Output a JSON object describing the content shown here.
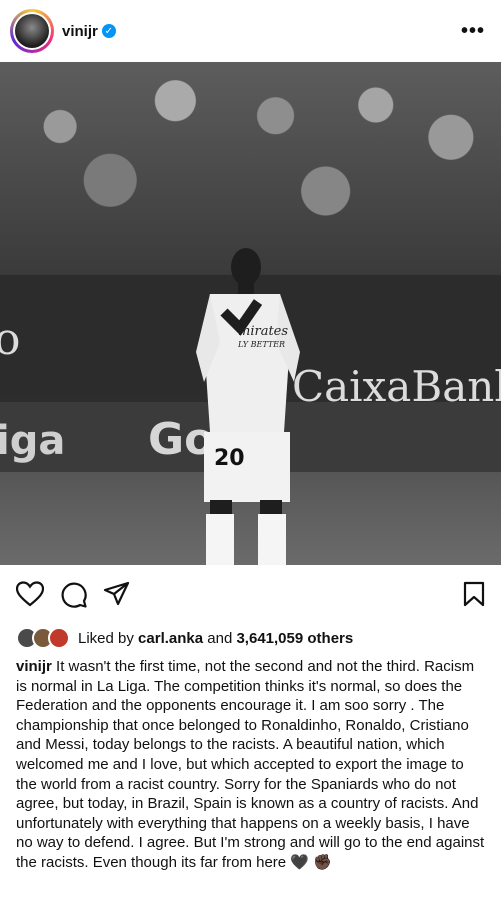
{
  "post": {
    "username": "vinijr",
    "verified_mark": "✓",
    "more_icon": "more-horizontal-icon",
    "photo": {
      "sponsor_board_main": "CaixaBank",
      "sponsor_board_left": "o",
      "sponsor_board_lower_left": "iga",
      "sponsor_board_lower_mid": "Go",
      "shirt_sponsor": "mirates",
      "shirt_sponsor_line2": "LY BETTER",
      "shirt_number": "20"
    },
    "actions": {
      "like_icon": "heart-icon",
      "comment_icon": "comment-icon",
      "share_icon": "paper-plane-icon",
      "save_icon": "bookmark-icon"
    },
    "likes": {
      "prefix": "Liked by",
      "user": "carl.anka",
      "connector": "and",
      "count": "3,641,059 others"
    },
    "caption": {
      "username": "vinijr",
      "text": "It wasn't the first time, not the second and not the third. Racism is normal in La Liga. The competition thinks it's normal, so does the Federation and the opponents encourage it. I am soo sorry . The championship that once belonged to Ronaldinho, Ronaldo, Cristiano and Messi, today belongs to the racists. A beautiful nation, which welcomed me and I love, but which accepted to export the image to the world from a racist country. Sorry for the Spaniards who do not agree, but today, in Brazil, Spain is known as a country of racists. And unfortunately with everything that happens on a weekly basis, I have no way to defend. I agree. But I'm strong and will go to the end against the racists. Even though its far from here",
      "emoji": "🖤 ✊🏿"
    }
  }
}
